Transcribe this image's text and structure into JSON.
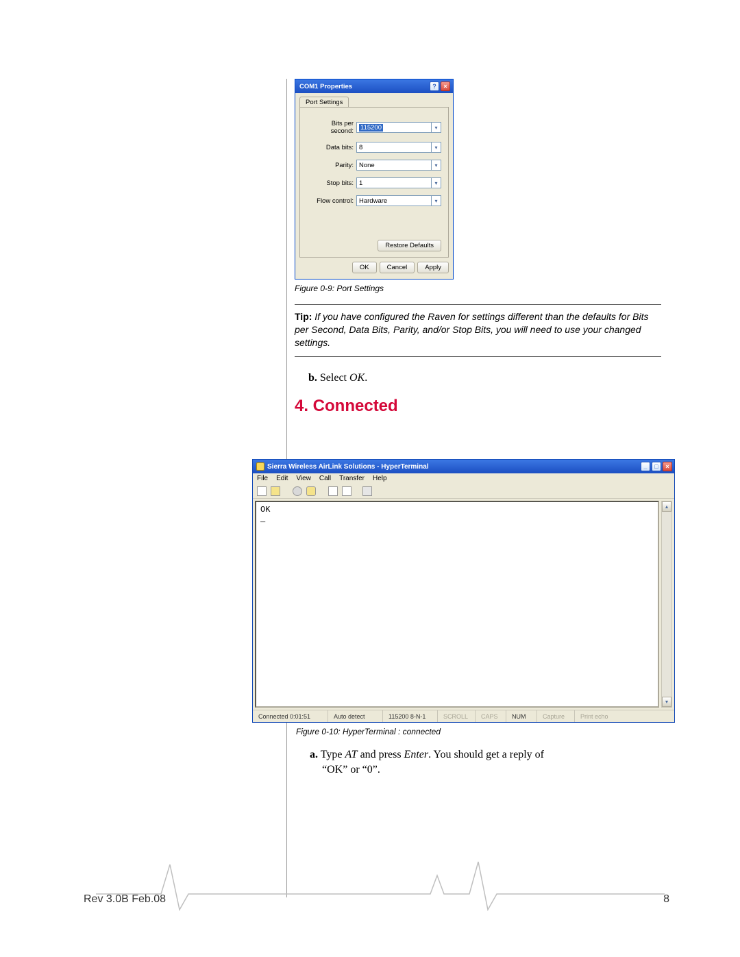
{
  "dialog": {
    "title": "COM1 Properties",
    "tab": "Port Settings",
    "fields": {
      "bits_per_second": {
        "label": "Bits per second:",
        "value": "115200"
      },
      "data_bits": {
        "label": "Data bits:",
        "value": "8"
      },
      "parity": {
        "label": "Parity:",
        "value": "None"
      },
      "stop_bits": {
        "label": "Stop bits:",
        "value": "1"
      },
      "flow_control": {
        "label": "Flow control:",
        "value": "Hardware"
      }
    },
    "restore_defaults": "Restore Defaults",
    "ok": "OK",
    "cancel": "Cancel",
    "apply": "Apply"
  },
  "fig9_caption": "Figure 0-9:  Port Settings",
  "tip": {
    "label": "Tip:",
    "body": "If you have configured the Raven for settings different than the defaults for Bits per Second, Data Bits, Parity, and/or Stop Bits, you will need to use your changed settings."
  },
  "step_b": {
    "letter": "b.",
    "text_pre": "Select ",
    "ok": "OK",
    "text_post": "."
  },
  "section_heading": "4. Connected",
  "hyperterminal": {
    "title": "Sierra Wireless AirLink Solutions - HyperTerminal",
    "menu": [
      "File",
      "Edit",
      "View",
      "Call",
      "Transfer",
      "Help"
    ],
    "terminal_text": "OK\n_",
    "status": {
      "connected": "Connected 0:01:51",
      "detect": "Auto detect",
      "mode": "115200 8-N-1",
      "scroll": "SCROLL",
      "caps": "CAPS",
      "num": "NUM",
      "capture": "Capture",
      "printecho": "Print echo"
    }
  },
  "fig10_caption": "Figure 0-10:  HyperTerminal : connected",
  "step_a": {
    "letter": "a.",
    "line1_pre": "Type ",
    "at": "AT",
    "line1_mid": " and press ",
    "enter": "Enter",
    "line1_post": ". You should get a reply of",
    "line2": "“OK” or “0”."
  },
  "footer": {
    "rev": "Rev 3.0B  Feb.08",
    "page": "8"
  }
}
